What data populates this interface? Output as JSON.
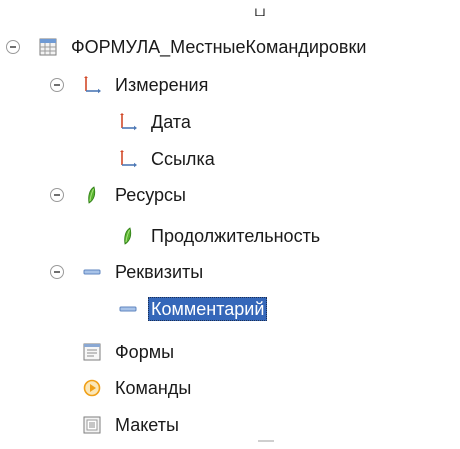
{
  "window": {
    "top_glyph": "ப"
  },
  "tree": {
    "root": {
      "label": "ФОРМУЛА_МестныеКомандировки",
      "icon": "register-table-icon",
      "expanded": true
    },
    "dimensions": {
      "label": "Измерения",
      "icon": "dimension-axis-icon",
      "expanded": true,
      "items": [
        {
          "label": "Дата",
          "icon": "dimension-axis-icon"
        },
        {
          "label": "Ссылка",
          "icon": "dimension-axis-icon"
        }
      ]
    },
    "resources": {
      "label": "Ресурсы",
      "icon": "resource-leaf-icon",
      "expanded": true,
      "items": [
        {
          "label": "Продолжительность",
          "icon": "resource-leaf-icon"
        }
      ]
    },
    "attributes": {
      "label": "Реквизиты",
      "icon": "attribute-dash-icon",
      "expanded": true,
      "items": [
        {
          "label": "Комментарий",
          "icon": "attribute-dash-icon",
          "selected": true
        }
      ]
    },
    "forms": {
      "label": "Формы",
      "icon": "form-icon"
    },
    "commands": {
      "label": "Команды",
      "icon": "command-play-icon"
    },
    "layouts": {
      "label": "Макеты",
      "icon": "layout-template-icon"
    }
  },
  "colors": {
    "selection_bg": "#3567b9",
    "leaf_green": "#58b32f",
    "axis_red": "#d24a2a",
    "dash_blue": "#7da0cf",
    "command_orange": "#f0a018"
  }
}
